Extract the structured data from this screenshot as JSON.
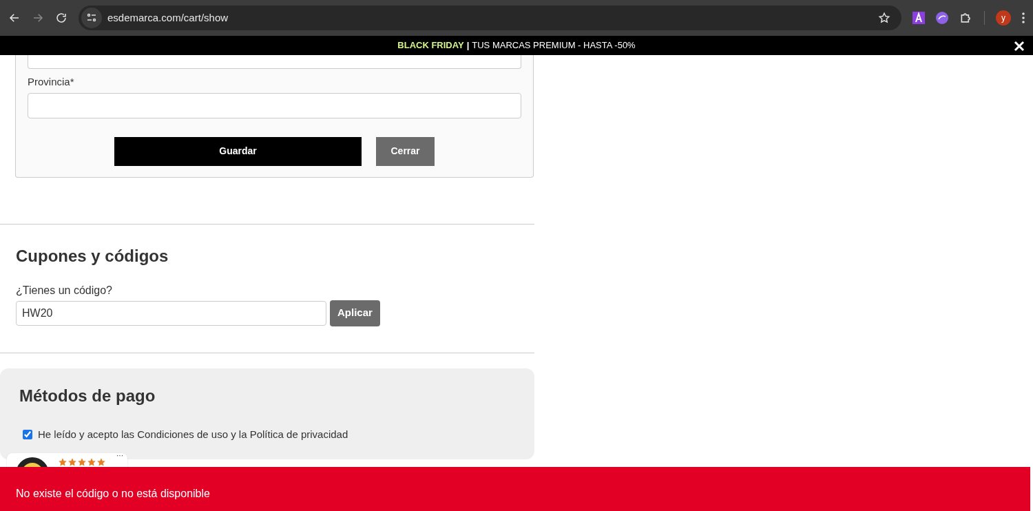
{
  "browser": {
    "url": "esdemarca.com/cart/show",
    "profile_initial": "y"
  },
  "promo_bar": {
    "highlight": "BLACK FRIDAY",
    "separator": "|",
    "text": "TUS MARCAS PREMIUM - HASTA -50%"
  },
  "address_form": {
    "fields": [
      {
        "label": "Provincia*"
      }
    ],
    "buttons": [
      {
        "label": "Guardar",
        "kind": "primary"
      },
      {
        "label": "Cerrar",
        "kind": "secondary"
      }
    ]
  },
  "coupons": {
    "title": "Cupones y códigos",
    "label": "¿Tienes un código?",
    "value": "HW20",
    "button": "Aplicar"
  },
  "payment": {
    "title": "Métodos de pago",
    "terms": {
      "text": "He leído y acepto las Condiciones de uso y la Política de privacidad",
      "checked": true
    }
  },
  "review_widget": {
    "stars": 5,
    "menu": "···"
  },
  "toast": {
    "message": "No existe el código o no está disponible"
  }
}
